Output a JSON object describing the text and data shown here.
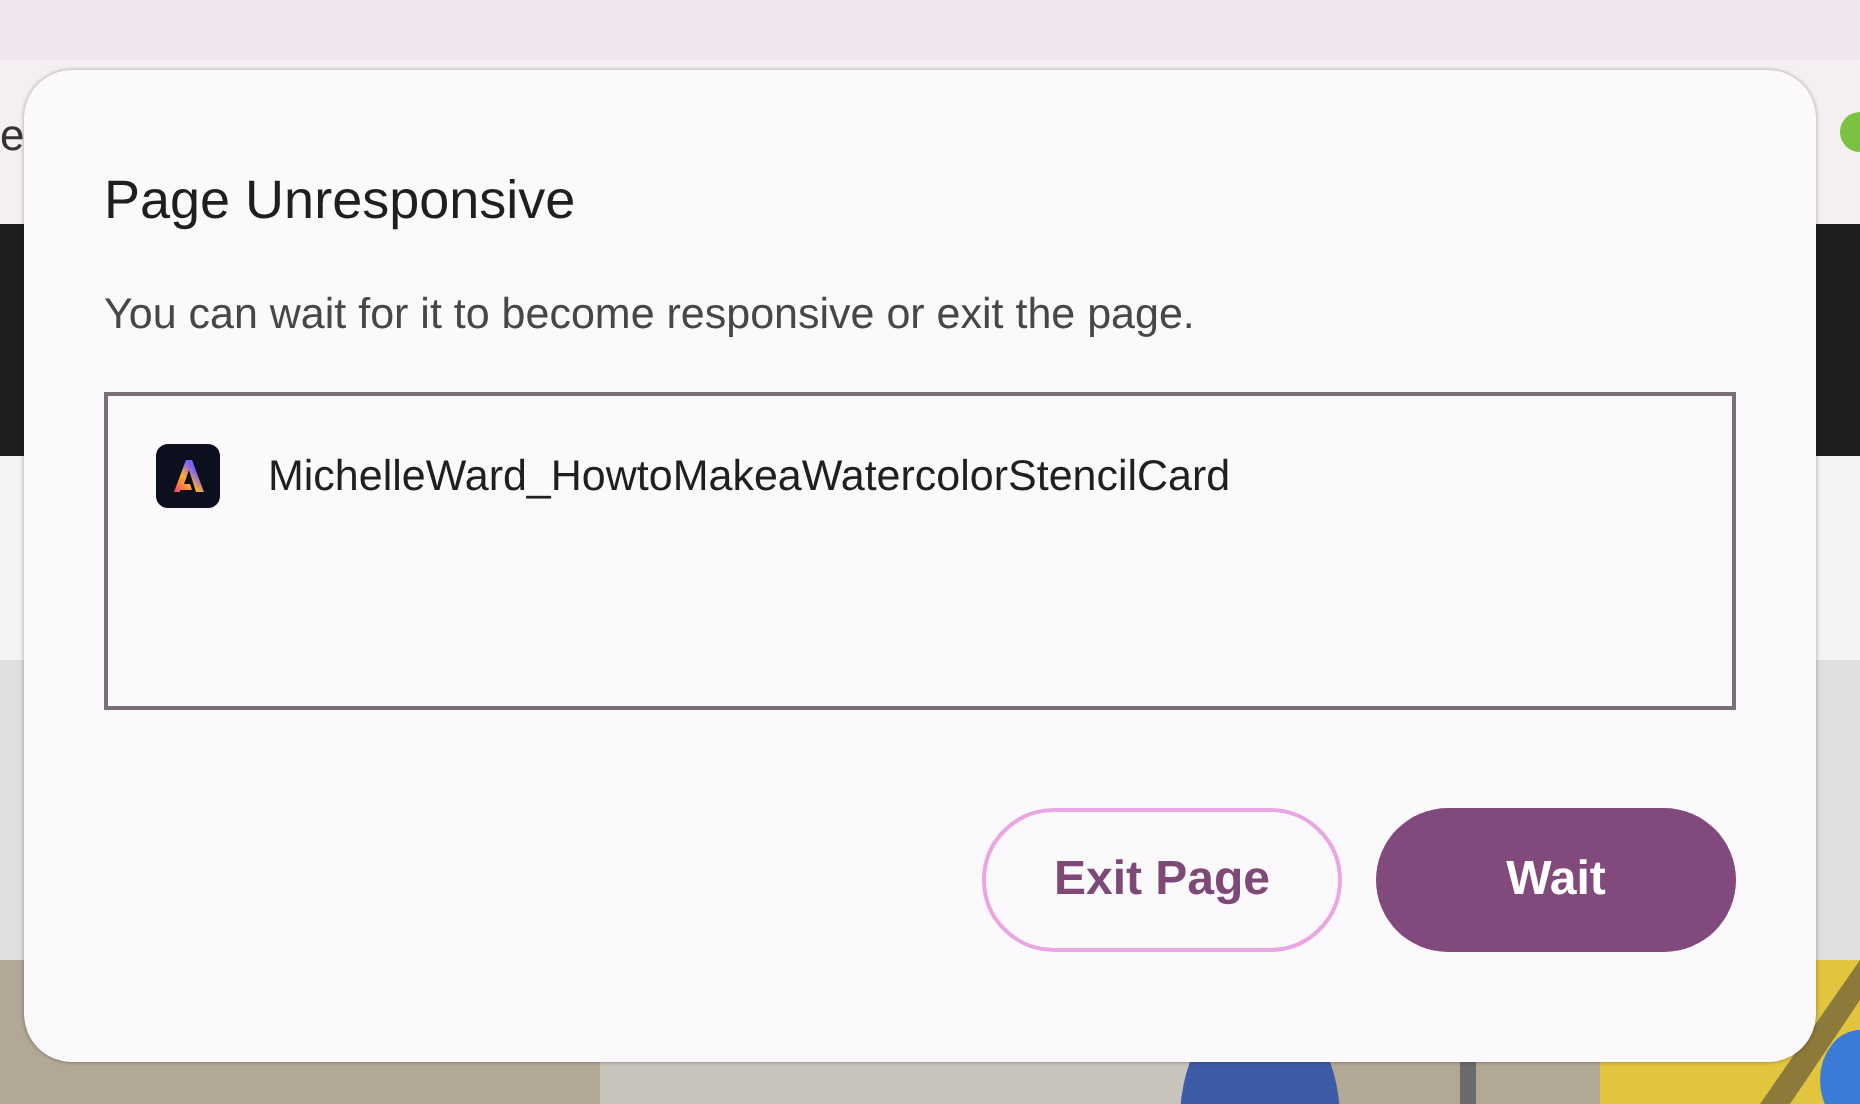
{
  "browser": {
    "tab_text": "e"
  },
  "dialog": {
    "title": "Page Unresponsive",
    "message": "You can wait for it to become responsive or exit the page.",
    "pages": [
      {
        "name": "MichelleWard_HowtoMakeaWatercolorStencilCard"
      }
    ],
    "buttons": [
      {
        "label": "Exit Page",
        "kind": "secondary"
      },
      {
        "label": "Wait",
        "kind": "primary"
      }
    ]
  }
}
